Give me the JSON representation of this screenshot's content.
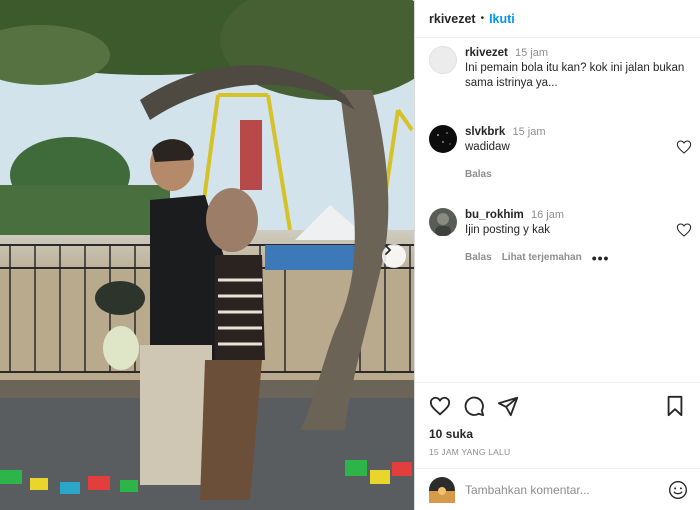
{
  "post": {
    "username": "rkivezet",
    "separator": "•",
    "follow_label": "Ikuti",
    "photo_alt": "photo",
    "next_icon": "chevron-right-icon"
  },
  "comments": [
    {
      "username": "rkivezet",
      "time": "15 jam",
      "text": "Ini pemain bola itu kan? kok ini jalan bukan sama istrinya ya...",
      "is_caption": true
    },
    {
      "username": "slvkbrk",
      "time": "15 jam",
      "text": "wadidaw",
      "reply_label": "Balas",
      "avatar_color": "#0c0c0c"
    },
    {
      "username": "bu_rokhim",
      "time": "16 jam",
      "text": "Ijin posting y kak",
      "reply_label": "Balas",
      "translate_label": "Lihat terjemahan",
      "more_label": "•••",
      "avatar_color": "#5a5d55"
    }
  ],
  "actions": {
    "likes": "10 suka",
    "time_ago": "15 JAM YANG LALU",
    "icons": [
      "heart-icon",
      "comment-icon",
      "share-icon",
      "bookmark-icon"
    ]
  },
  "add_comment": {
    "placeholder": "Tambahkan komentar...",
    "emoji_icon": "emoji-icon"
  },
  "colors": {
    "accent": "#0095f6",
    "muted": "#8e8e8e",
    "text": "#262626"
  }
}
